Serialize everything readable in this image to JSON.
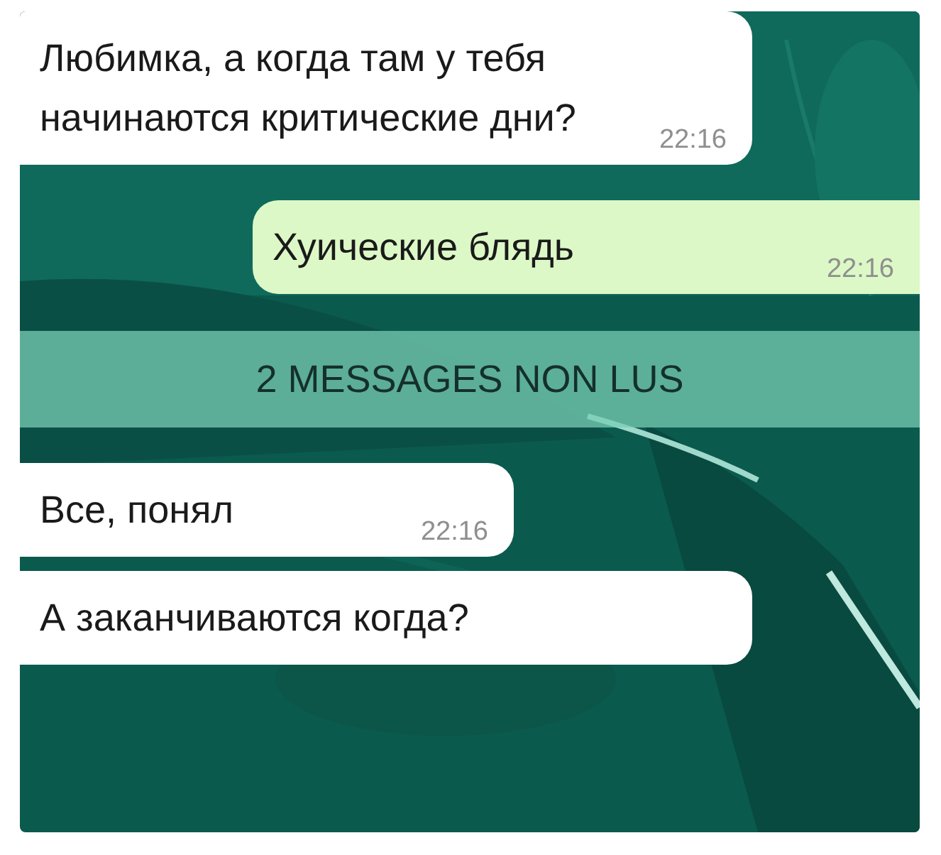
{
  "chat": {
    "items": [
      {
        "kind": "incoming",
        "text": "Любимка, а когда там у тебя начинаются критические дни?",
        "time": "22:16"
      },
      {
        "kind": "outgoing",
        "text": "Хуические блядь",
        "time": "22:16"
      },
      {
        "kind": "banner",
        "text": "2 MESSAGES NON LUS"
      },
      {
        "kind": "incoming",
        "text": "Все, понял",
        "time": "22:16"
      },
      {
        "kind": "incoming",
        "text": "А заканчиваются когда?"
      }
    ]
  }
}
